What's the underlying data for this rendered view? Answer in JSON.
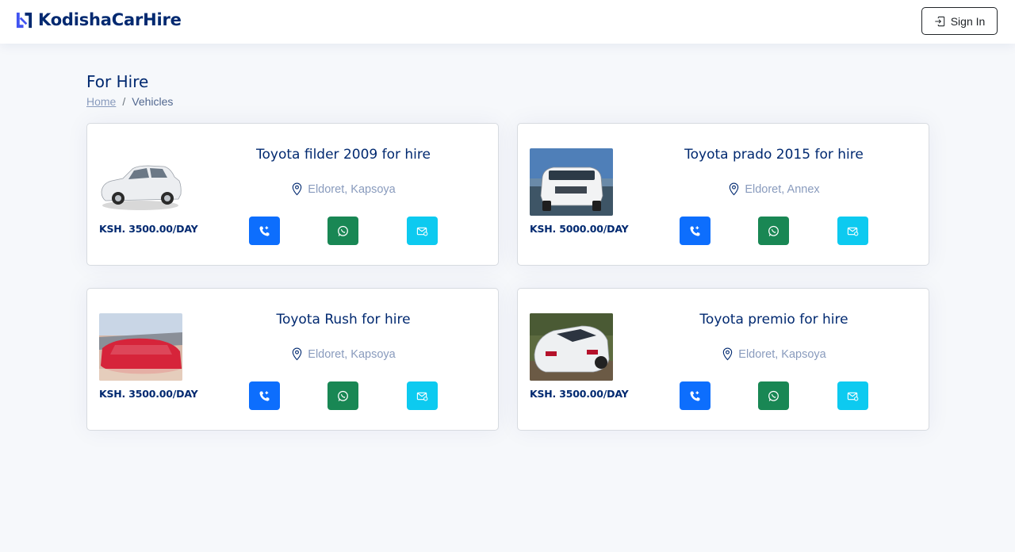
{
  "header": {
    "brand": "KodishaCarHire",
    "signin_label": "Sign In"
  },
  "page": {
    "title": "For Hire",
    "breadcrumb": {
      "home": "Home",
      "separator": "/",
      "current": "Vehicles"
    }
  },
  "colors": {
    "primary": "#012970",
    "call": "#0d6efd",
    "whatsapp": "#198754",
    "email": "#0dcaf0",
    "muted": "#899bbd"
  },
  "vehicles": [
    {
      "title": "Toyota filder 2009 for hire",
      "location": "Eldoret, Kapsoya",
      "price": "KSH. 3500.00/DAY",
      "image": "white-sedan-car"
    },
    {
      "title": "Toyota prado 2015 for hire",
      "location": "Eldoret, Annex",
      "price": "KSH. 5000.00/DAY",
      "image": "white-suv-car"
    },
    {
      "title": "Toyota Rush for hire",
      "location": "Eldoret, Kapsoya",
      "price": "KSH. 3500.00/DAY",
      "image": "red-compact-suv"
    },
    {
      "title": "Toyota premio for hire",
      "location": "Eldoret, Kapsoya",
      "price": "KSH. 3500.00/DAY",
      "image": "white-sedan-rear"
    }
  ],
  "icons": {
    "call": "phone-plus-icon",
    "whatsapp": "whatsapp-icon",
    "email": "envelope-icon",
    "location": "geo-pin-icon",
    "signin": "box-arrow-in-right-icon"
  }
}
